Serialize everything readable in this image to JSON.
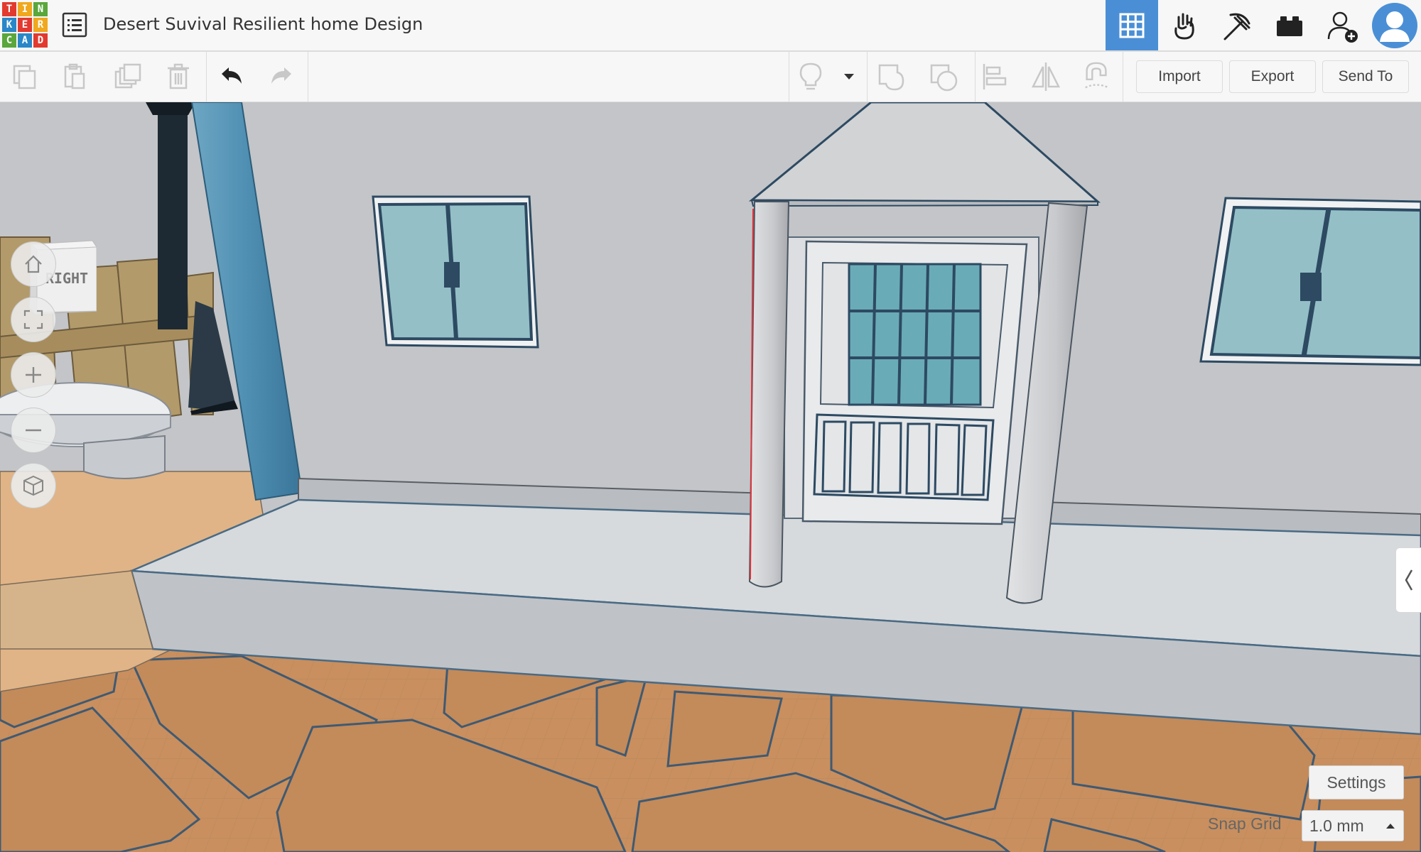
{
  "app": {
    "logo_letters": [
      "T",
      "I",
      "N",
      "K",
      "E",
      "R",
      "C",
      "A",
      "D"
    ],
    "logo_colors": [
      "#e23a2f",
      "#f0a81e",
      "#5aa73c",
      "#2a87c8",
      "#e23a2f",
      "#f0a81e",
      "#5aa73c",
      "#2a87c8",
      "#e23a2f"
    ],
    "design_title": "Desert Suvival Resilient home Design",
    "accent_color": "#4a8fd6"
  },
  "top_icons": [
    "grid-view-icon",
    "tinker-hand-icon",
    "pickaxe-icon",
    "bricks-icon",
    "add-user-icon",
    "profile-avatar-icon"
  ],
  "toolbar": {
    "import_label": "Import",
    "export_label": "Export",
    "send_to_label": "Send To"
  },
  "viewcube": {
    "face_label": "RIGHT"
  },
  "nav_controls": [
    "home-view-icon",
    "fit-view-icon",
    "zoom-in-icon",
    "zoom-out-icon",
    "ortho-view-icon"
  ],
  "footer": {
    "settings_label": "Settings",
    "snap_grid_label": "Snap Grid",
    "snap_grid_value": "1.0 mm"
  }
}
